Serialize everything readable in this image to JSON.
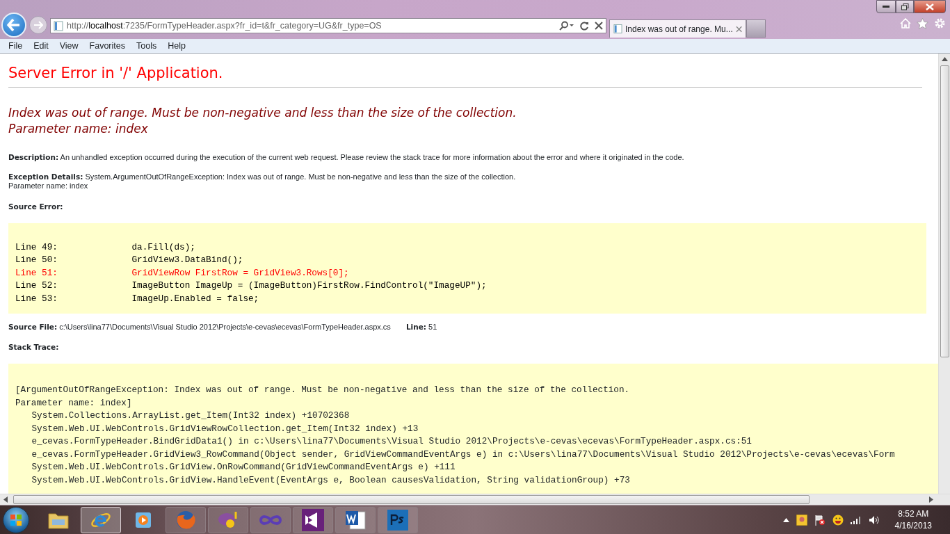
{
  "browser": {
    "address": {
      "scheme": "http://",
      "host": "localhost",
      "rest": ":7235/FormTypeHeader.aspx?fr_id=t&fr_category=UG&fr_type=OS"
    },
    "tabs": [
      {
        "title": "Index was out of range. Mu...",
        "selected": true
      }
    ],
    "menu": [
      "File",
      "Edit",
      "View",
      "Favorites",
      "Tools",
      "Help"
    ]
  },
  "page": {
    "title": "Server Error in '/' Application.",
    "message": [
      "Index was out of range. Must be non-negative and less than the size of the collection.",
      "Parameter name: index"
    ],
    "description": {
      "label": "Description:",
      "text": "An unhandled exception occurred during the execution of the current web request. Please review the stack trace for more information about the error and where it originated in the code."
    },
    "exception_details": {
      "label": "Exception Details:",
      "text": "System.ArgumentOutOfRangeException: Index was out of range. Must be non-negative and less than the size of the collection.",
      "text_2": "Parameter name: index"
    },
    "source_error": {
      "label": "Source Error:",
      "lines": [
        {
          "label": "Line 49:",
          "code": "da.Fill(ds);",
          "highlighted": false
        },
        {
          "label": "Line 50:",
          "code": "GridView3.DataBind();",
          "highlighted": false
        },
        {
          "label": "Line 51:",
          "code": "GridViewRow FirstRow = GridView3.Rows[0];",
          "highlighted": true
        },
        {
          "label": "Line 52:",
          "code": "ImageButton ImageUp = (ImageButton)FirstRow.FindControl(\"ImageUP\");",
          "highlighted": false
        },
        {
          "label": "Line 53:",
          "code": "ImageUp.Enabled = false;",
          "highlighted": false
        }
      ]
    },
    "source_file": {
      "label": "Source File:",
      "path": "c:\\Users\\lina77\\Documents\\Visual Studio 2012\\Projects\\e-cevas\\ecevas\\FormTypeHeader.aspx.cs",
      "line_label": "Line:",
      "line": "51"
    },
    "stack_trace": {
      "label": "Stack Trace:",
      "lines": [
        {
          "kind": "header",
          "text": "[ArgumentOutOfRangeException: Index was out of range. Must be non-negative and less than the size of the collection."
        },
        {
          "kind": "header",
          "text": "Parameter name: index]"
        },
        {
          "kind": "frame",
          "text": "System.Collections.ArrayList.get_Item(Int32 index) +10702368"
        },
        {
          "kind": "frame",
          "text": "System.Web.UI.WebControls.GridViewRowCollection.get_Item(Int32 index) +13"
        },
        {
          "kind": "frame",
          "text": "e_cevas.FormTypeHeader.BindGridData1() in c:\\Users\\lina77\\Documents\\Visual Studio 2012\\Projects\\e-cevas\\ecevas\\FormTypeHeader.aspx.cs:51"
        },
        {
          "kind": "frame",
          "text": "e_cevas.FormTypeHeader.GridView3_RowCommand(Object sender, GridViewCommandEventArgs e) in c:\\Users\\lina77\\Documents\\Visual Studio 2012\\Projects\\e-cevas\\ecevas\\Form"
        },
        {
          "kind": "frame",
          "text": "System.Web.UI.WebControls.GridView.OnRowCommand(GridViewCommandEventArgs e) +111"
        },
        {
          "kind": "frame",
          "text": "System.Web.UI.WebControls.GridView.HandleEvent(EventArgs e, Boolean causesValidation, String validationGroup) +73"
        }
      ]
    }
  },
  "taskbar": {
    "apps": [
      {
        "kind": "folder",
        "selected": false
      },
      {
        "kind": "ie",
        "selected": true
      },
      {
        "kind": "media",
        "selected": false
      },
      {
        "kind": "firefox",
        "selected": false
      },
      {
        "kind": "messenger",
        "selected": false
      },
      {
        "kind": "infinity",
        "selected": false
      },
      {
        "kind": "vs",
        "selected": false
      },
      {
        "kind": "word",
        "selected": false
      },
      {
        "kind": "ps",
        "selected": false
      }
    ],
    "tray": {
      "time": "8:52 AM",
      "date": "4/16/2013"
    }
  }
}
